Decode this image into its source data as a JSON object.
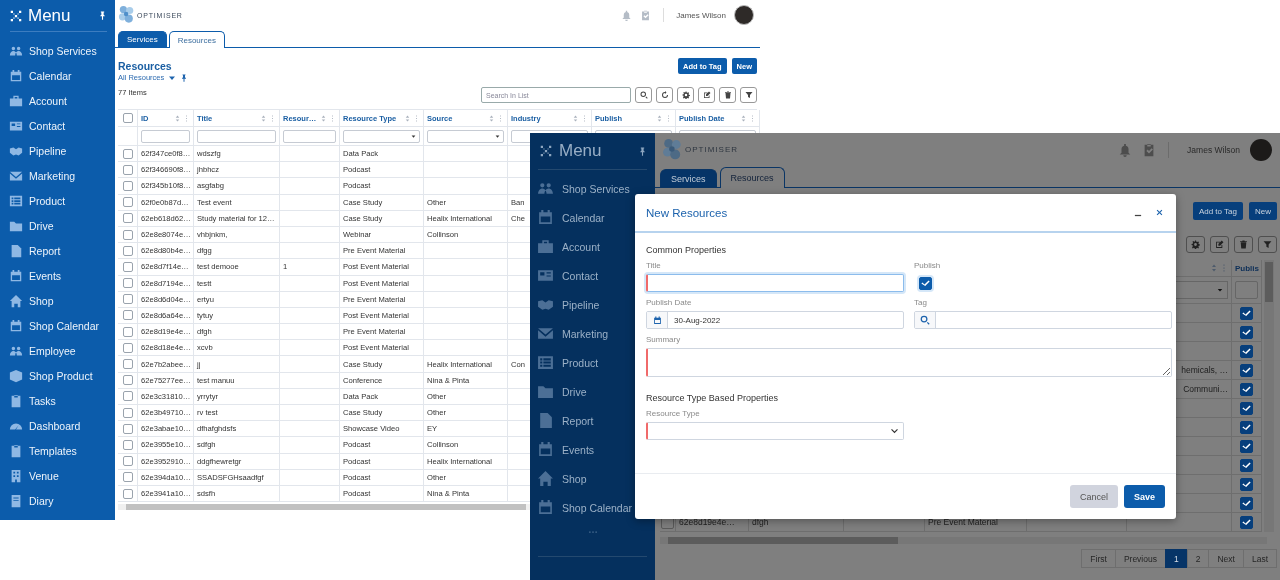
{
  "main_screen": {
    "sidebar": {
      "title": "Menu",
      "items": [
        "Shop Services",
        "Calendar",
        "Account",
        "Contact",
        "Pipeline",
        "Marketing",
        "Product",
        "Drive",
        "Report",
        "Events",
        "Shop",
        "Shop Calendar",
        "Employee",
        "Shop Product",
        "Tasks",
        "Dashboard",
        "Templates",
        "Venue",
        "Diary"
      ]
    },
    "header": {
      "logo": "OPTIMISER",
      "user": "James Wilson"
    },
    "tabs": [
      {
        "label": "Services",
        "selected": false
      },
      {
        "label": "Resources",
        "selected": true
      }
    ],
    "page": {
      "title": "Resources",
      "view": "All Resources",
      "count": "77 Items"
    },
    "buttons": [
      "Add to Tag",
      "New"
    ],
    "search": {
      "placeholder": "Search In List"
    },
    "table": {
      "all_selected": false,
      "columns": [
        {
          "label": "ID",
          "kind": "text"
        },
        {
          "label": "Title",
          "kind": "text"
        },
        {
          "label": "Resour…",
          "kind": "text"
        },
        {
          "label": "Resource Type",
          "kind": "select"
        },
        {
          "label": "Source",
          "kind": "select"
        },
        {
          "label": "Industry",
          "kind": "select"
        },
        {
          "label": "Publish",
          "kind": "text"
        },
        {
          "label": "Publish Date",
          "kind": "text"
        }
      ],
      "rows": [
        {
          "id": "62f347ce0f8…",
          "title": "wdszfg",
          "type": "Data Pack",
          "selected": false
        },
        {
          "id": "62f346690f8…",
          "title": "jhbhcz",
          "type": "Podcast",
          "selected": false
        },
        {
          "id": "62f345b10f8…",
          "title": "asgfabg",
          "type": "Podcast",
          "selected": false
        },
        {
          "id": "62f0e0b87d…",
          "title": "Test event",
          "type": "Case Study",
          "source": "Other",
          "industry": "Ban",
          "selected": false
        },
        {
          "id": "62eb618d62…",
          "title": "Study material for 12…",
          "type": "Case Study",
          "source": "Healix International",
          "industry": "Che",
          "selected": false
        },
        {
          "id": "62e8e8074e…",
          "title": "vhbjnkm,",
          "type": "Webinar",
          "source": "Collinson",
          "selected": false
        },
        {
          "id": "62e8d80b4e…",
          "title": "dfgg",
          "type": "Pre Event Material",
          "selected": false
        },
        {
          "id": "62e8d7f14e…",
          "title": "test demooe",
          "resources": "1",
          "type": "Post Event Material",
          "selected": false
        },
        {
          "id": "62e8d7194e…",
          "title": "testt",
          "type": "Post Event Material",
          "selected": false
        },
        {
          "id": "62e8d6d04e…",
          "title": "ertyu",
          "type": "Pre Event Material",
          "selected": false
        },
        {
          "id": "62e8d6a64e…",
          "title": "tytuy",
          "type": "Post Event Material",
          "selected": false
        },
        {
          "id": "62e8d19e4e…",
          "title": "dfgh",
          "type": "Pre Event Material",
          "selected": false
        },
        {
          "id": "62e8d18e4e…",
          "title": "xcvb",
          "type": "Post Event Material",
          "selected": false
        },
        {
          "id": "62e7b2abee…",
          "title": "jj",
          "type": "Case Study",
          "source": "Healix International",
          "industry": "Con",
          "selected": false
        },
        {
          "id": "62e75277ee…",
          "title": "test manuu",
          "type": "Conference",
          "source": "Nina & Pinta",
          "selected": false
        },
        {
          "id": "62e3c31810…",
          "title": "yrrytyr",
          "type": "Data Pack",
          "source": "Other",
          "selected": false
        },
        {
          "id": "62e3b49710…",
          "title": "rv test",
          "type": "Case Study",
          "source": "Other",
          "selected": false
        },
        {
          "id": "62e3abae10…",
          "title": "dfhafghdsfs",
          "type": "Showcase Video",
          "source": "EY",
          "selected": false
        },
        {
          "id": "62e3955e10…",
          "title": "sdfgh",
          "type": "Podcast",
          "source": "Collinson",
          "selected": false
        },
        {
          "id": "62e3952910…",
          "title": "ddgfhewretgr",
          "type": "Podcast",
          "source": "Healix International",
          "selected": false
        },
        {
          "id": "62e394da10…",
          "title": "SSADSFGHsaadfgf",
          "type": "Podcast",
          "source": "Other",
          "selected": false
        },
        {
          "id": "62e3941a10…",
          "title": "sdsfh",
          "type": "Podcast",
          "source": "Nina & Pinta",
          "selected": false
        }
      ]
    }
  },
  "dialog_screen": {
    "sidebar": {
      "title": "Menu",
      "items": [
        "Shop Services",
        "Calendar",
        "Account",
        "Contact",
        "Pipeline",
        "Marketing",
        "Product",
        "Drive",
        "Report",
        "Events",
        "Shop",
        "Shop Calendar"
      ]
    },
    "header": {
      "logo": "OPTIMISER",
      "user": "James Wilson"
    },
    "tabs": [
      {
        "label": "Services",
        "selected": false
      },
      {
        "label": "Resources",
        "selected": true
      }
    ],
    "buttons": [
      "Add to Tag",
      "New"
    ],
    "table": {
      "publish_header": "Publis",
      "rows": [
        {
          "checked": true
        },
        {
          "checked": true
        },
        {
          "checked": true
        },
        {
          "industry": "hemicals, …",
          "checked": true
        },
        {
          "industry": "Communi…",
          "checked": true
        },
        {
          "checked": true
        },
        {
          "checked": true
        },
        {
          "checked": true
        },
        {
          "checked": true
        },
        {
          "checked": true
        },
        {
          "checked": true
        },
        {
          "id": "62e8d19e4e…",
          "title": "dfgh",
          "type": "Pre Event Material",
          "selected": false,
          "checked": true
        }
      ]
    },
    "pagination": [
      {
        "label": "First",
        "selected": false
      },
      {
        "label": "Previous",
        "selected": false
      },
      {
        "label": "1",
        "selected": true
      },
      {
        "label": "2",
        "selected": false
      },
      {
        "label": "Next",
        "selected": false
      },
      {
        "label": "Last",
        "selected": false
      }
    ],
    "modal": {
      "title": "New Resources",
      "common_heading": "Common Properties",
      "fields": [
        {
          "kind": "text",
          "label": "Title",
          "required": true,
          "focused": true
        },
        {
          "kind": "checkbox",
          "label": "Publish",
          "checked": true
        },
        {
          "kind": "date",
          "label": "Publish Date",
          "value": "30-Aug-2022",
          "required": false
        },
        {
          "kind": "search",
          "label": "Tag",
          "required": false
        },
        {
          "kind": "textarea",
          "label": "Summary",
          "required": true
        }
      ],
      "type_heading": "Resource Type Based Properties",
      "type_fields": [
        {
          "kind": "select",
          "label": "Resource Type",
          "required": true
        }
      ],
      "buttons": [
        {
          "label": "Cancel",
          "kind": "secondary"
        },
        {
          "label": "Save",
          "kind": "primary"
        }
      ]
    }
  }
}
